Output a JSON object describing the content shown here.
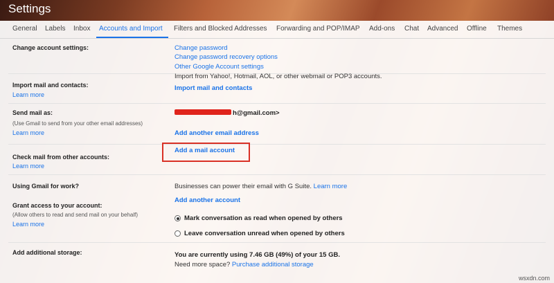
{
  "window": {
    "title": "Settings"
  },
  "tabs": [
    {
      "label": "General"
    },
    {
      "label": "Labels"
    },
    {
      "label": "Inbox"
    },
    {
      "label": "Accounts and Import",
      "active": true
    },
    {
      "label": "Filters and Blocked Addresses"
    },
    {
      "label": "Forwarding and POP/IMAP"
    },
    {
      "label": "Add-ons"
    },
    {
      "label": "Chat"
    },
    {
      "label": "Advanced"
    },
    {
      "label": "Offline"
    },
    {
      "label": "Themes"
    }
  ],
  "sections": {
    "change_account": {
      "label": "Change account settings:",
      "links": [
        "Change password",
        "Change password recovery options",
        "Other Google Account settings"
      ]
    },
    "import_mail": {
      "label": "Import mail and contacts:",
      "learn_more": "Learn more",
      "note": "Import from Yahoo!, Hotmail, AOL, or other webmail or POP3 accounts.",
      "action": "Import mail and contacts"
    },
    "send_mail": {
      "label": "Send mail as:",
      "sub": "(Use Gmail to send from your other email addresses)",
      "learn_more": "Learn more",
      "address_suffix": "h@gmail.com>",
      "action": "Add another email address"
    },
    "check_mail": {
      "label": "Check mail from other accounts:",
      "learn_more": "Learn more",
      "action": "Add a mail account"
    },
    "gmail_work": {
      "label": "Using Gmail for work?",
      "text": "Businesses can power their email with G Suite.",
      "learn_more": "Learn more"
    },
    "grant_access": {
      "label": "Grant access to your account:",
      "sub": "(Allow others to read and send mail on your behalf)",
      "learn_more": "Learn more",
      "action": "Add another account",
      "options": [
        {
          "label": "Mark conversation as read when opened by others",
          "selected": true
        },
        {
          "label": "Leave conversation unread when opened by others",
          "selected": false
        }
      ]
    },
    "storage": {
      "label": "Add additional storage:",
      "usage": "You are currently using 7.46 GB (49%) of your 15 GB.",
      "need_more": "Need more space?",
      "purchase": "Purchase additional storage"
    }
  },
  "watermark": "wsxdn.com",
  "colors": {
    "link": "#1a73e8",
    "highlight_box": "#d93025",
    "redaction": "#e0241c"
  }
}
